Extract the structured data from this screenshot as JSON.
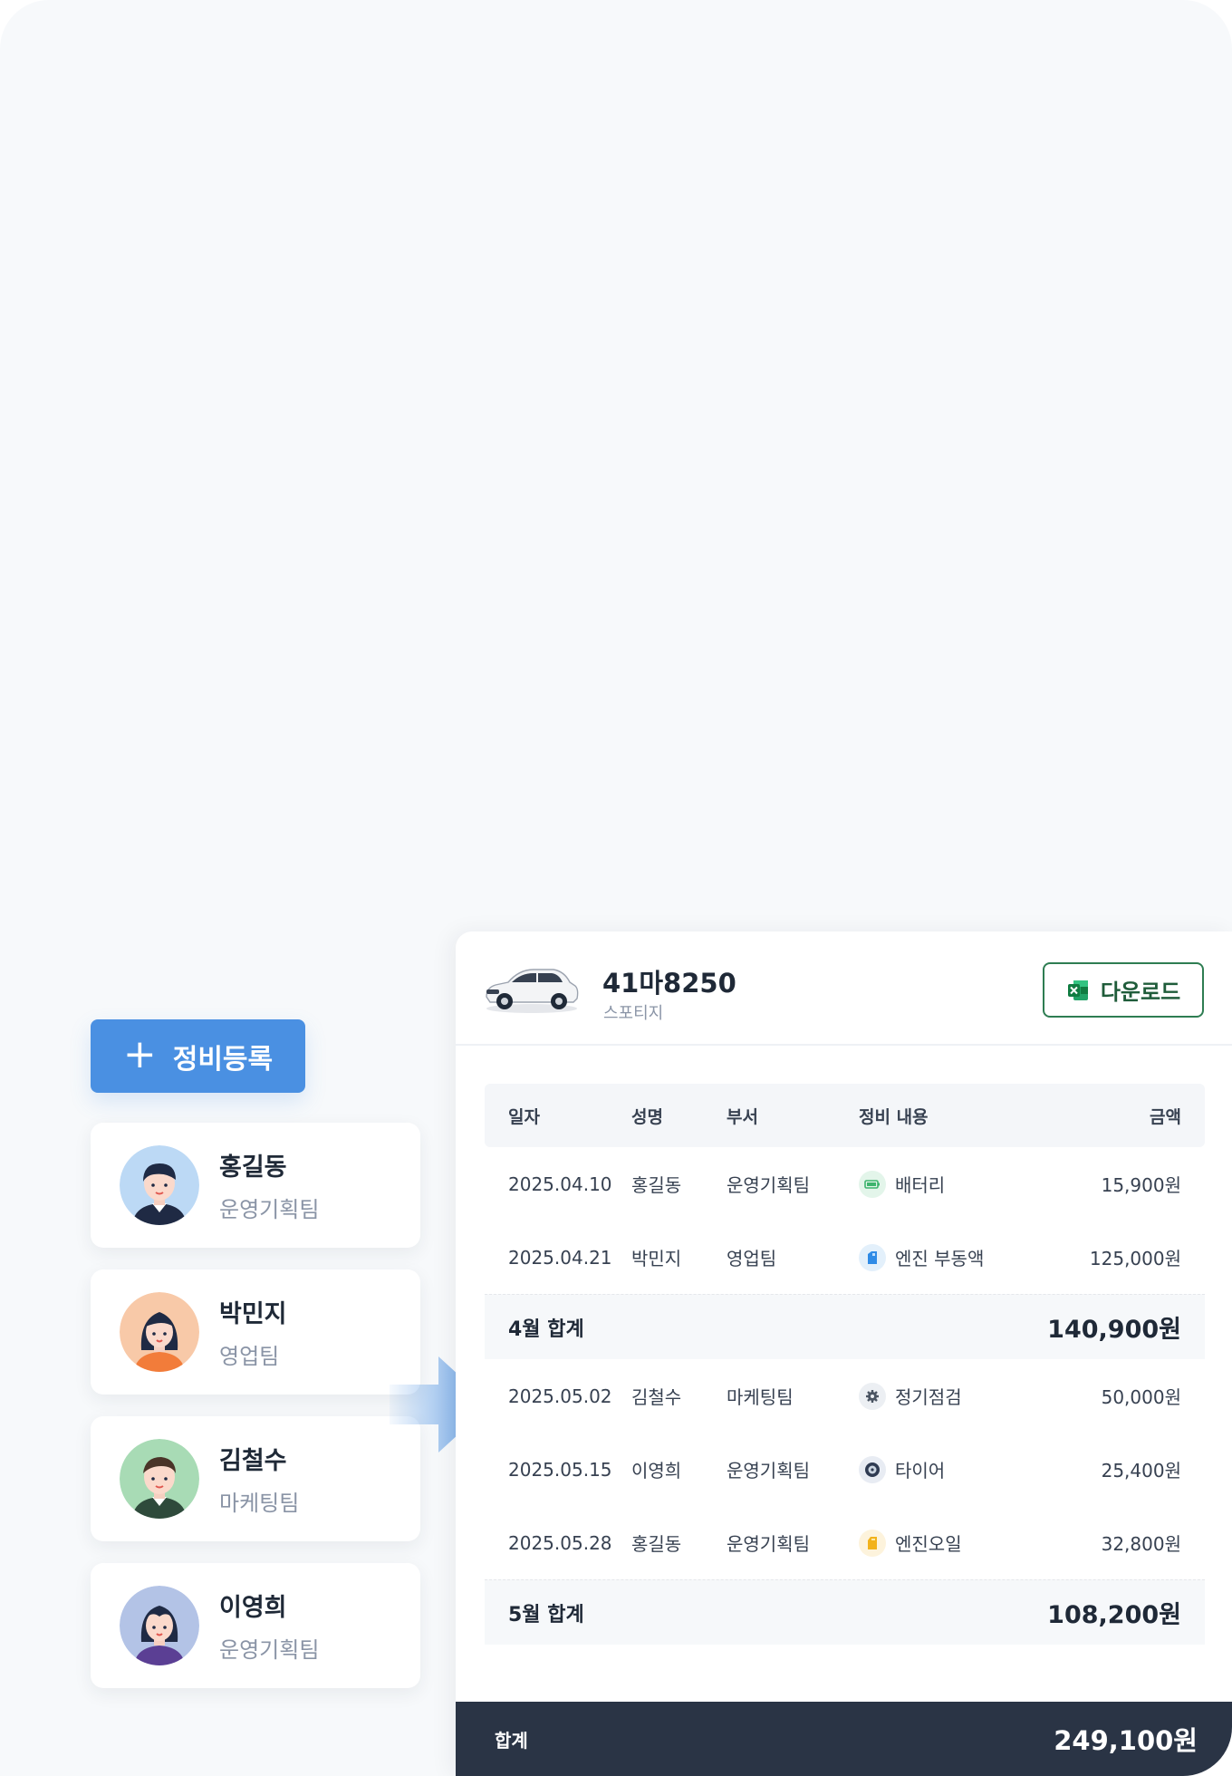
{
  "register_button": {
    "label": "정비등록",
    "icon": "plus-icon"
  },
  "people": [
    {
      "name": "홍길동",
      "dept": "운영기획팀",
      "avatar_bg": "#bcd9f5"
    },
    {
      "name": "박민지",
      "dept": "영업팀",
      "avatar_bg": "#f8c9a8"
    },
    {
      "name": "김철수",
      "dept": "마케팅팀",
      "avatar_bg": "#a8dbb5"
    },
    {
      "name": "이영희",
      "dept": "운영기획팀",
      "avatar_bg": "#b3c3e6"
    }
  ],
  "vehicle": {
    "plate": "41마8250",
    "model": "스포티지"
  },
  "download_button": {
    "label": "다운로드",
    "icon": "excel-icon"
  },
  "table": {
    "headers": {
      "date": "일자",
      "name": "성명",
      "dept": "부서",
      "item": "정비 내용",
      "amount": "금액"
    },
    "groups": [
      {
        "rows": [
          {
            "date": "2025.04.10",
            "name": "홍길동",
            "dept": "운영기획팀",
            "item": "배터리",
            "icon": "battery-icon",
            "amount": "15,900원"
          },
          {
            "date": "2025.04.21",
            "name": "박민지",
            "dept": "영업팀",
            "item": "엔진 부동액",
            "icon": "coolant-icon",
            "amount": "125,000원"
          }
        ],
        "subtotal_label": "4월 합계",
        "subtotal_value": "140,900원"
      },
      {
        "rows": [
          {
            "date": "2025.05.02",
            "name": "김철수",
            "dept": "마케팅팀",
            "item": "정기점검",
            "icon": "gear-icon",
            "amount": "50,000원"
          },
          {
            "date": "2025.05.15",
            "name": "이영희",
            "dept": "운영기획팀",
            "item": "타이어",
            "icon": "tire-icon",
            "amount": "25,400원"
          },
          {
            "date": "2025.05.28",
            "name": "홍길동",
            "dept": "운영기획팀",
            "item": "엔진오일",
            "icon": "oil-icon",
            "amount": "32,800원"
          }
        ],
        "subtotal_label": "5월 합계",
        "subtotal_value": "108,200원"
      }
    ]
  },
  "total": {
    "label": "합계",
    "value": "249,100원"
  },
  "colors": {
    "accent": "#4a90e2",
    "footer": "#2a3445",
    "excel_green": "#2e7d52"
  }
}
